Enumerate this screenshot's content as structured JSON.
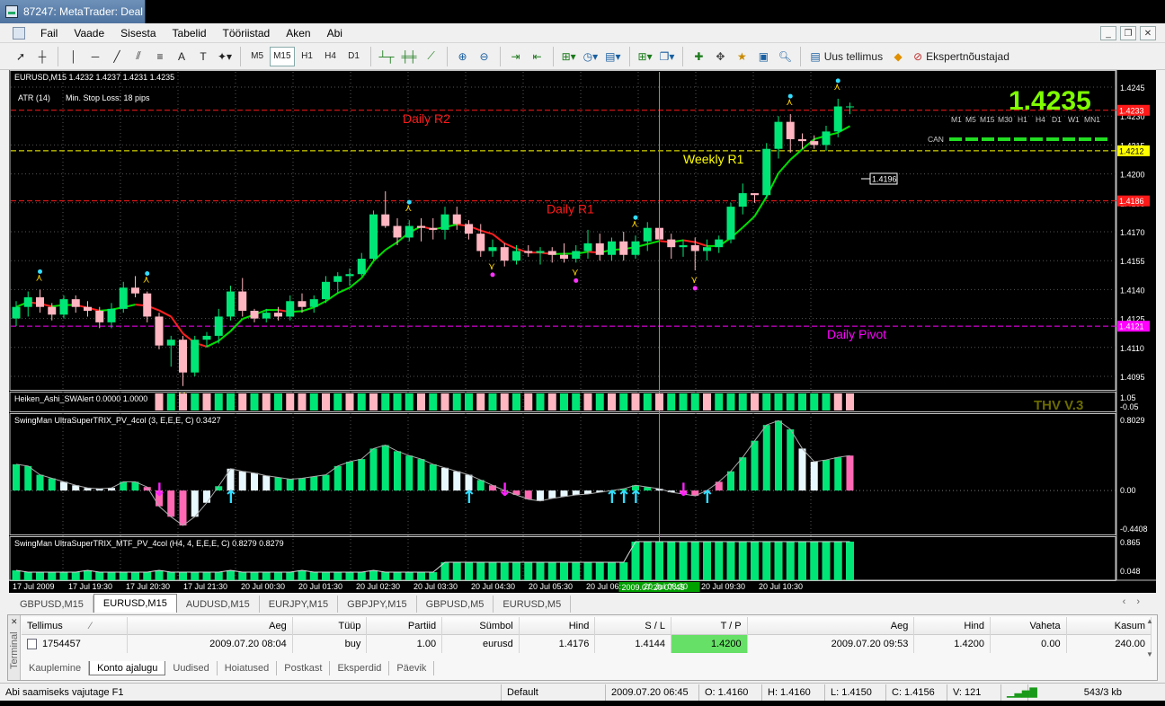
{
  "window": {
    "title": "87247: MetaTrader: Deal"
  },
  "menu": [
    "Fail",
    "Vaade",
    "Sisesta",
    "Tabelid",
    "Tööriistad",
    "Aken",
    "Abi"
  ],
  "toolbar": {
    "timeframes": [
      "M5",
      "M15",
      "H1",
      "H4",
      "D1"
    ],
    "active_timeframe": "M15",
    "new_order": "Uus tellimus",
    "expert_advisors": "Ekspertnõustajad"
  },
  "chart": {
    "header": "EURUSD,M15  1.4232 1.4237 1.4231 1.4235",
    "atr_label": "ATR (14)",
    "stop_loss_label": "Min. Stop Loss:  18 pips",
    "big_price": "1.4235",
    "tf_row": [
      "M1",
      "M5",
      "M15",
      "M30",
      "H1",
      "H4",
      "D1",
      "W1",
      "MN1"
    ],
    "can_label": "CAN",
    "levels": [
      {
        "name": "Daily R2",
        "price": 1.4233,
        "color": "#ff1a1a"
      },
      {
        "name": "Weekly R1",
        "price": 1.4212,
        "color": "#ffff00"
      },
      {
        "name": "Daily R1",
        "price": 1.4186,
        "color": "#ff1a1a"
      },
      {
        "name": "Daily Pivot",
        "price": 1.4121,
        "color": "#ff00ff"
      }
    ],
    "level_tags": [
      "1.4233",
      "1.4212",
      "1.4186",
      "1.4121"
    ],
    "price_ticks": [
      "1.4245",
      "1.4230",
      "1.4215",
      "1.4200",
      "1.4185",
      "1.4170",
      "1.4155",
      "1.4140",
      "1.4125",
      "1.4110",
      "1.4095"
    ],
    "price_tick_values": [
      1.4245,
      1.423,
      1.4215,
      1.42,
      1.4185,
      1.417,
      1.4155,
      1.414,
      1.4125,
      1.411,
      1.4095
    ],
    "cursor_price": "1.4196",
    "heiken_label": "Heiken_Ashi_SWAlert 0.0000 1.0000",
    "heiken_scale": [
      "1.05",
      "-0.05"
    ],
    "thv_label": "THV V.3",
    "trix_label": "SwingMan UltraSuperTRIX_PV_4col (3, E,E,E, C) 0.3427",
    "trix_scale": [
      "0.8029",
      "0.00",
      "-0.4408"
    ],
    "trix_mtf_label": "SwingMan UltraSuperTRIX_MTF_PV_4col (H4, 4, E,E,E, C) 0.8279 0.8279",
    "trix_mtf_scale": [
      "0.865",
      "0.048"
    ],
    "time_labels": [
      "17 Jul 2009",
      "17 Jul 19:30",
      "17 Jul 20:30",
      "17 Jul 21:30",
      "20 Jul 00:30",
      "20 Jul 01:30",
      "20 Jul 02:30",
      "20 Jul 03:30",
      "20 Jul 04:30",
      "20 Jul 05:30",
      "20 Jul 06:",
      "20 Jul 08:30",
      "20 Jul 09:30",
      "20 Jul 10:30"
    ],
    "cursor_time": "2009.07.20 07:45",
    "candles": [
      [
        1.4125,
        1.4134,
        1.4121,
        1.4131
      ],
      [
        1.4131,
        1.4139,
        1.4126,
        1.4136
      ],
      [
        1.4136,
        1.414,
        1.4128,
        1.4131
      ],
      [
        1.4131,
        1.4133,
        1.4124,
        1.4127
      ],
      [
        1.4127,
        1.4137,
        1.4125,
        1.4135
      ],
      [
        1.4135,
        1.4137,
        1.4128,
        1.4131
      ],
      [
        1.4131,
        1.4134,
        1.4126,
        1.4129
      ],
      [
        1.4129,
        1.4131,
        1.412,
        1.4123
      ],
      [
        1.4123,
        1.4133,
        1.412,
        1.413
      ],
      [
        1.413,
        1.4144,
        1.4128,
        1.4141
      ],
      [
        1.4141,
        1.4147,
        1.4136,
        1.4138
      ],
      [
        1.4138,
        1.4139,
        1.4123,
        1.4126
      ],
      [
        1.4126,
        1.4128,
        1.4109,
        1.4111
      ],
      [
        1.4111,
        1.4116,
        1.41,
        1.4114
      ],
      [
        1.4114,
        1.4116,
        1.409,
        1.4097
      ],
      [
        1.4097,
        1.4116,
        1.4095,
        1.4114
      ],
      [
        1.4114,
        1.4118,
        1.411,
        1.4116
      ],
      [
        1.4116,
        1.413,
        1.4112,
        1.4126
      ],
      [
        1.4126,
        1.4142,
        1.4124,
        1.4139
      ],
      [
        1.4139,
        1.4146,
        1.4126,
        1.4129
      ],
      [
        1.4129,
        1.413,
        1.4123,
        1.4125
      ],
      [
        1.4125,
        1.413,
        1.4123,
        1.4128
      ],
      [
        1.4128,
        1.4131,
        1.4124,
        1.4126
      ],
      [
        1.4126,
        1.4137,
        1.4124,
        1.4134
      ],
      [
        1.4134,
        1.4138,
        1.4128,
        1.4131
      ],
      [
        1.4131,
        1.4137,
        1.4128,
        1.4135
      ],
      [
        1.4135,
        1.4147,
        1.4133,
        1.4144
      ],
      [
        1.4144,
        1.4149,
        1.4138,
        1.4147
      ],
      [
        1.4147,
        1.4151,
        1.4142,
        1.4148
      ],
      [
        1.4148,
        1.4159,
        1.4147,
        1.4156
      ],
      [
        1.4156,
        1.4181,
        1.4155,
        1.4179
      ],
      [
        1.4179,
        1.4191,
        1.4172,
        1.4173
      ],
      [
        1.4173,
        1.4177,
        1.4163,
        1.4167
      ],
      [
        1.4167,
        1.4176,
        1.4165,
        1.4173
      ],
      [
        1.4173,
        1.4177,
        1.4165,
        1.4172
      ],
      [
        1.4172,
        1.4177,
        1.4166,
        1.4171
      ],
      [
        1.4171,
        1.4183,
        1.4166,
        1.4179
      ],
      [
        1.4179,
        1.4183,
        1.4171,
        1.4174
      ],
      [
        1.4174,
        1.4176,
        1.4166,
        1.4169
      ],
      [
        1.4169,
        1.4174,
        1.4157,
        1.416
      ],
      [
        1.416,
        1.4166,
        1.4157,
        1.4162
      ],
      [
        1.4162,
        1.4164,
        1.4152,
        1.4155
      ],
      [
        1.4155,
        1.4163,
        1.4153,
        1.416
      ],
      [
        1.416,
        1.4163,
        1.4157,
        1.4159
      ],
      [
        1.4159,
        1.4162,
        1.4153,
        1.416
      ],
      [
        1.416,
        1.4162,
        1.4154,
        1.4158
      ],
      [
        1.4158,
        1.4164,
        1.4154,
        1.4156
      ],
      [
        1.4156,
        1.4163,
        1.4154,
        1.416
      ],
      [
        1.416,
        1.4171,
        1.4156,
        1.4164
      ],
      [
        1.4164,
        1.4169,
        1.4155,
        1.4158
      ],
      [
        1.4158,
        1.4167,
        1.4155,
        1.4165
      ],
      [
        1.4165,
        1.417,
        1.4155,
        1.4158
      ],
      [
        1.4158,
        1.4168,
        1.4156,
        1.4165
      ],
      [
        1.4165,
        1.4175,
        1.416,
        1.4172
      ],
      [
        1.4172,
        1.4179,
        1.4164,
        1.4166
      ],
      [
        1.4166,
        1.4169,
        1.4156,
        1.4162
      ],
      [
        1.4162,
        1.4166,
        1.4157,
        1.4163
      ],
      [
        1.4163,
        1.4167,
        1.415,
        1.416
      ],
      [
        1.416,
        1.4166,
        1.4155,
        1.4162
      ],
      [
        1.4162,
        1.4168,
        1.4159,
        1.4166
      ],
      [
        1.4166,
        1.4185,
        1.4164,
        1.4183
      ],
      [
        1.4183,
        1.4195,
        1.4179,
        1.419
      ],
      [
        1.419,
        1.419,
        1.4185,
        1.4189
      ],
      [
        1.4189,
        1.4216,
        1.4187,
        1.4213
      ],
      [
        1.4213,
        1.423,
        1.4208,
        1.4227
      ],
      [
        1.4227,
        1.4231,
        1.4211,
        1.4218
      ],
      [
        1.4218,
        1.4221,
        1.4213,
        1.4217
      ],
      [
        1.4217,
        1.422,
        1.4213,
        1.4215
      ],
      [
        1.4215,
        1.4225,
        1.4212,
        1.4222
      ],
      [
        1.4222,
        1.4239,
        1.4219,
        1.4235
      ],
      [
        1.4235,
        1.4237,
        1.4231,
        1.4235
      ]
    ],
    "ha_colors": "pppppppgpgpgpgpgpggpgpgppgpgpgpgggpgpggpgpgpgpggpgpgpgpgggpgggpgggggg",
    "trix": [
      0.3,
      0.28,
      0.18,
      0.14,
      0.1,
      0.06,
      0.03,
      0.02,
      0.03,
      0.1,
      0.1,
      0.04,
      -0.18,
      -0.3,
      -0.4,
      -0.3,
      -0.14,
      0.05,
      0.25,
      0.22,
      0.2,
      0.17,
      0.15,
      0.13,
      0.14,
      0.16,
      0.18,
      0.28,
      0.33,
      0.36,
      0.48,
      0.52,
      0.45,
      0.4,
      0.36,
      0.3,
      0.26,
      0.22,
      0.18,
      0.12,
      0.06,
      0.0,
      -0.05,
      -0.1,
      -0.12,
      -0.09,
      -0.07,
      -0.05,
      -0.04,
      -0.02,
      0.0,
      0.02,
      0.06,
      0.04,
      0.02,
      -0.02,
      -0.04,
      -0.06,
      0.0,
      0.1,
      0.22,
      0.38,
      0.57,
      0.75,
      0.8,
      0.7,
      0.48,
      0.33,
      0.35,
      0.38,
      0.4
    ],
    "trix_colors": "ggggwwwwwggmmmmwwgwwwwggggggggggggggwwwgmmmmwwwwwwggggwwmmmmggggggwwgg",
    "trix_mtf_start_tall": 52,
    "arrows_up": [
      18,
      38,
      50,
      51,
      52,
      58
    ],
    "arrows_down": [
      12,
      41,
      56
    ]
  },
  "symbol_tabs": [
    "GBPUSD,M15",
    "EURUSD,M15",
    "AUDUSD,M15",
    "EURJPY,M15",
    "GBPJPY,M15",
    "GBPUSD,M5",
    "EURUSD,M5"
  ],
  "active_symbol_tab": "EURUSD,M15",
  "terminal": {
    "side_label": "Terminal",
    "headers": [
      "Tellimus",
      "Aeg",
      "Tüüp",
      "Partiid",
      "Sümbol",
      "Hind",
      "S / L",
      "T / P",
      "Aeg",
      "Hind",
      "Vaheta",
      "Kasum"
    ],
    "row": [
      "1754457",
      "2009.07.20 08:04",
      "buy",
      "1.00",
      "eurusd",
      "1.4176",
      "1.4144",
      "1.4200",
      "2009.07.20 09:53",
      "1.4200",
      "0.00",
      "240.00"
    ],
    "tabs": [
      "Kauplemine",
      "Konto ajalugu",
      "Uudised",
      "Hoiatused",
      "Postkast",
      "Eksperdid",
      "Päevik"
    ],
    "active_tab": "Konto ajalugu"
  },
  "status": {
    "help": "Abi saamiseks vajutage F1",
    "profile": "Default",
    "time": "2009.07.20 06:45",
    "open": "O: 1.4160",
    "high": "H: 1.4160",
    "low": "L: 1.4150",
    "close": "C: 1.4156",
    "volume": "V: 121",
    "traffic": "543/3 kb"
  },
  "colors": {
    "bull": "#00e676",
    "bear": "#ffb6c1",
    "trix_white": "#e8f8ff",
    "trix_magenta": "#ff69b4"
  }
}
